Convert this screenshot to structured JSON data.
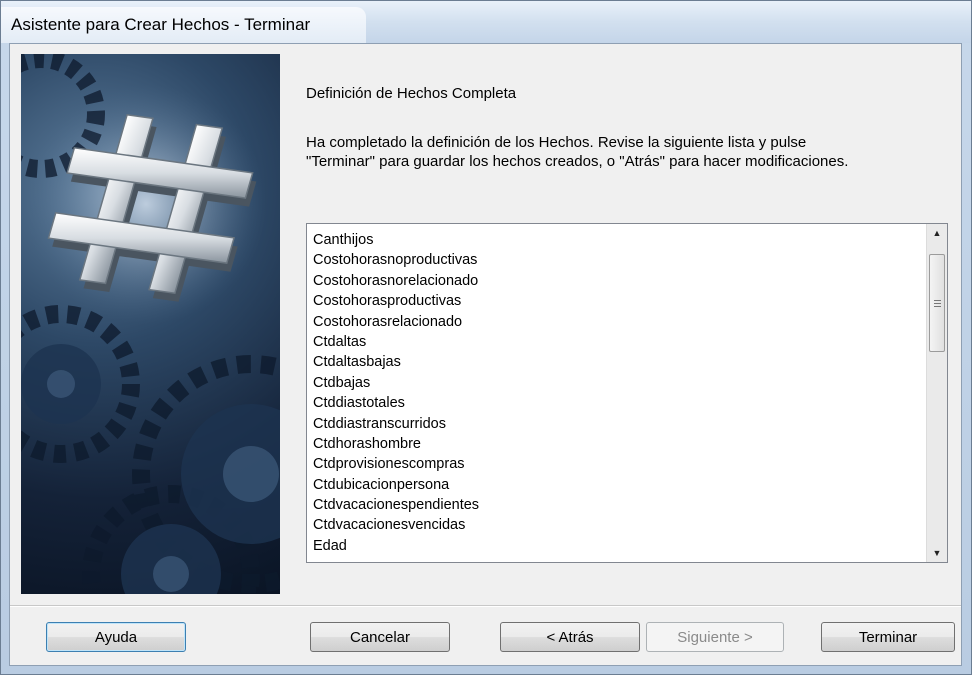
{
  "window": {
    "title": "Asistente para Crear Hechos - Terminar"
  },
  "side_image": {
    "icon": "hash-gears-image"
  },
  "content": {
    "heading": "Definición de Hechos Completa",
    "description_line1": "Ha completado la definición de los Hechos. Revise la siguiente lista y pulse",
    "description_line2": "\"Terminar\" para guardar los hechos creados, o \"Atrás\" para hacer modificaciones."
  },
  "facts_list": {
    "items": [
      "Canthijos",
      "Costohorasnoproductivas",
      "Costohorasnorelacionado",
      "Costohorasproductivas",
      "Costohorasrelacionado",
      "Ctdaltas",
      "Ctdaltasbajas",
      "Ctdbajas",
      "Ctddiastotales",
      "Ctddiastranscurridos",
      "Ctdhorashombre",
      "Ctdprovisionescompras",
      "Ctdubicacionpersona",
      "Ctdvacacionespendientes",
      "Ctdvacacionesvencidas",
      "Edad"
    ],
    "scroll_up_icon": "▲",
    "scroll_down_icon": "▼"
  },
  "buttons": {
    "help": "Ayuda",
    "cancel": "Cancelar",
    "back": "< Atrás",
    "next": "Siguiente >",
    "finish": "Terminar"
  },
  "colors": {
    "title_bar": "#d2e0ef",
    "client_bg": "#f0f0f0",
    "focus_border": "#3c7fb1"
  }
}
